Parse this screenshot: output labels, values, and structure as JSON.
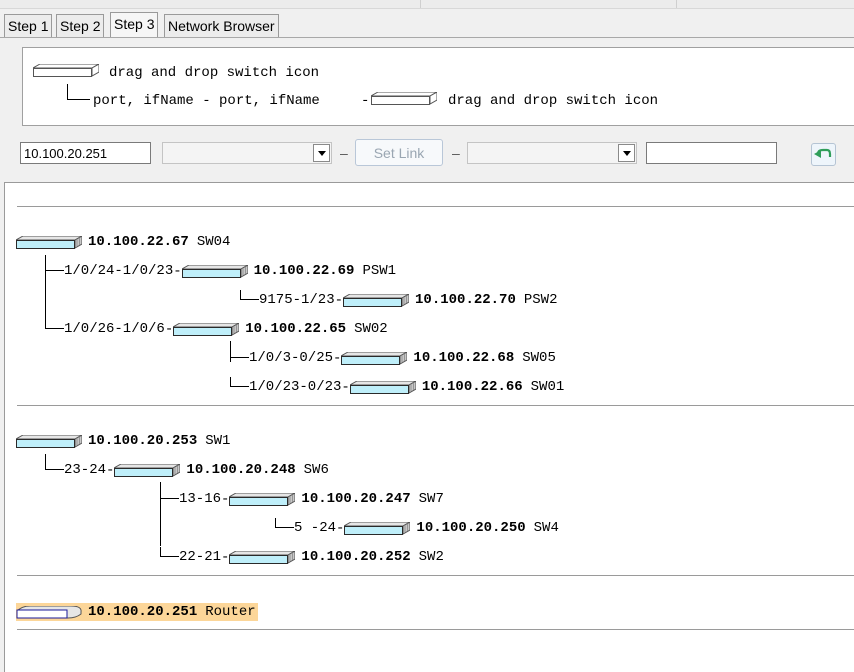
{
  "tabs": [
    {
      "label": "Step 1"
    },
    {
      "label": "Step 2"
    },
    {
      "label": "Step 3"
    },
    {
      "label": "Network Browser"
    }
  ],
  "legend": {
    "line1": "drag and drop switch icon",
    "line2": "port, ifName - port, ifName",
    "line2_suffix": "drag and drop switch icon"
  },
  "controls": {
    "ip_value": "10.100.20.251",
    "separator": "–",
    "set_link_label": "Set Link",
    "left_port_value": "",
    "right_port_value": "",
    "right_value": ""
  },
  "groups": [
    {
      "root": {
        "ip": "10.100.22.67",
        "name": "SW04"
      },
      "children": [
        {
          "ports": "1/0/24-1/0/23",
          "ip": "10.100.22.69",
          "name": "PSW1",
          "children": [
            {
              "ports": "9175-1/23",
              "ip": "10.100.22.70",
              "name": "PSW2"
            }
          ]
        },
        {
          "ports": "1/0/26-1/0/6",
          "ip": "10.100.22.65",
          "name": "SW02",
          "children": [
            {
              "ports": "1/0/3-0/25",
              "ip": "10.100.22.68",
              "name": "SW05"
            },
            {
              "ports": "1/0/23-0/23",
              "ip": "10.100.22.66",
              "name": "SW01"
            }
          ]
        }
      ]
    },
    {
      "root": {
        "ip": "10.100.20.253",
        "name": "SW1"
      },
      "children": [
        {
          "ports": "23-24",
          "ip": "10.100.20.248",
          "name": "SW6",
          "children": [
            {
              "ports": "13-16",
              "ip": "10.100.20.247",
              "name": "SW7",
              "children": [
                {
                  "ports": "5 -24",
                  "ip": "10.100.20.250",
                  "name": "SW4"
                }
              ]
            },
            {
              "ports": "22-21",
              "ip": "10.100.20.252",
              "name": "SW2"
            }
          ]
        }
      ]
    }
  ],
  "router": {
    "ip": "10.100.20.251",
    "name": "Router"
  },
  "colors": {
    "switch_face": "#bfeffa",
    "router_highlight": "#fcd699"
  }
}
